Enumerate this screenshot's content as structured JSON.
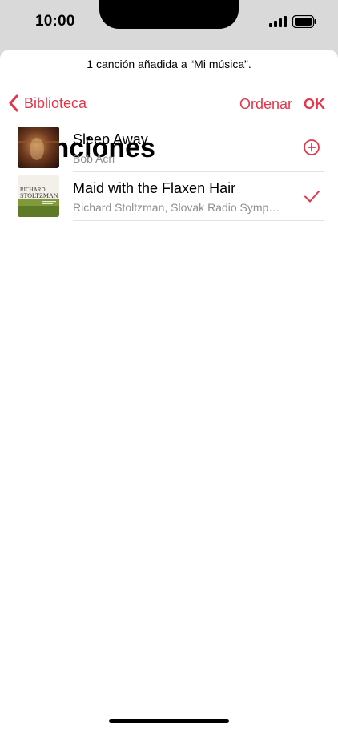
{
  "status_bar": {
    "time": "10:00"
  },
  "toast": {
    "message": "1 canción añadida a “Mi música”."
  },
  "nav": {
    "back_label": "Biblioteca",
    "sort_label": "Ordenar",
    "done_label": "OK"
  },
  "page": {
    "title": "Canciones"
  },
  "songs": [
    {
      "title": "Sleep Away",
      "artist": "Bob Acri",
      "action": "add-circle-icon"
    },
    {
      "title": "Maid with the Flaxen Hair",
      "artist": "Richard Stoltzman, Slovak Radio Symp…",
      "action": "checkmark-icon",
      "artwork_text": [
        "RICHARD",
        "STOLTZMAN"
      ]
    }
  ],
  "colors": {
    "accent": "#e2364a",
    "secondary_text": "#8e8e93",
    "status_bar_bg": "#d9d9d9"
  }
}
